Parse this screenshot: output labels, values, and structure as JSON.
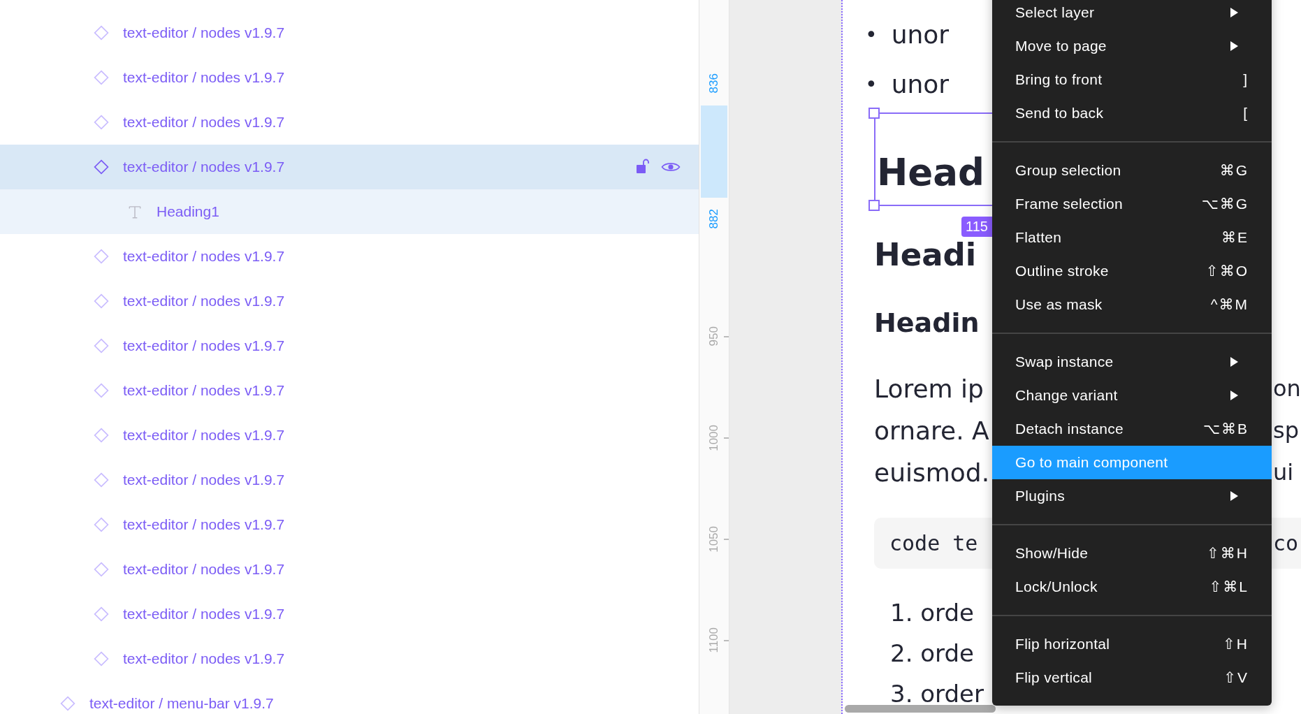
{
  "layers": [
    {
      "children": [
        {
          "name": "text-editor / nodes v1.9.7",
          "kind": "component",
          "selected": false
        },
        {
          "name": "text-editor / nodes v1.9.7",
          "kind": "component",
          "selected": false
        },
        {
          "name": "text-editor / nodes v1.9.7",
          "kind": "component",
          "selected": false
        },
        {
          "name": "text-editor / nodes v1.9.7",
          "kind": "component",
          "selected": true,
          "children": [
            {
              "name": "Heading1",
              "kind": "text",
              "selected": false
            }
          ]
        },
        {
          "name": "text-editor / nodes v1.9.7",
          "kind": "component",
          "selected": false
        },
        {
          "name": "text-editor / nodes v1.9.7",
          "kind": "component",
          "selected": false
        },
        {
          "name": "text-editor / nodes v1.9.7",
          "kind": "component",
          "selected": false
        },
        {
          "name": "text-editor / nodes v1.9.7",
          "kind": "component",
          "selected": false
        },
        {
          "name": "text-editor / nodes v1.9.7",
          "kind": "component",
          "selected": false
        },
        {
          "name": "text-editor / nodes v1.9.7",
          "kind": "component",
          "selected": false
        },
        {
          "name": "text-editor / nodes v1.9.7",
          "kind": "component",
          "selected": false
        },
        {
          "name": "text-editor / nodes v1.9.7",
          "kind": "component",
          "selected": false
        },
        {
          "name": "text-editor / nodes v1.9.7",
          "kind": "component",
          "selected": false
        },
        {
          "name": "text-editor / nodes v1.9.7",
          "kind": "component",
          "selected": false
        }
      ]
    },
    {
      "name": "text-editor / menu-bar v1.9.7",
      "kind": "component",
      "selected": false
    }
  ],
  "ruler": {
    "marks": [
      {
        "label": "836",
        "kind": "bound"
      },
      {
        "label": "882",
        "kind": "bound"
      },
      {
        "label": "950",
        "kind": "tick"
      },
      {
        "label": "1000",
        "kind": "tick"
      },
      {
        "label": "1050",
        "kind": "tick"
      },
      {
        "label": "1100",
        "kind": "tick"
      }
    ]
  },
  "canvas": {
    "lines": [
      {
        "kind": "bullet",
        "marker": "•",
        "text": "unor"
      },
      {
        "kind": "bullet",
        "marker": "•",
        "text": "unor"
      },
      {
        "kind": "h1",
        "text": "Head",
        "selected": true,
        "badge": "115"
      },
      {
        "kind": "h2",
        "text": "Headi"
      },
      {
        "kind": "h3",
        "text": "Headin"
      },
      {
        "kind": "p",
        "text": "Lorem ip",
        "right": "on"
      },
      {
        "kind": "p",
        "text": "ornare. A",
        "right": "sp"
      },
      {
        "kind": "p",
        "text": "euismod.",
        "right": "ui"
      },
      {
        "kind": "code",
        "text": "code te",
        "right": "co"
      },
      {
        "kind": "ordered",
        "text": "1. orde"
      },
      {
        "kind": "ordered",
        "text": "2. orde"
      },
      {
        "kind": "ordered",
        "text": "3. order"
      }
    ]
  },
  "context_menu": {
    "sections": [
      [
        {
          "label": "Select layer",
          "submenu": true,
          "selected": false
        },
        {
          "label": "Move to page",
          "submenu": true,
          "selected": false
        },
        {
          "label": "Bring to front",
          "shortcut": "]",
          "selected": false
        },
        {
          "label": "Send to back",
          "shortcut": "[",
          "selected": false
        }
      ],
      [
        {
          "label": "Group selection",
          "shortcut": "⌘G",
          "selected": false
        },
        {
          "label": "Frame selection",
          "shortcut": "⌥⌘G",
          "selected": false
        },
        {
          "label": "Flatten",
          "shortcut": "⌘E",
          "selected": false
        },
        {
          "label": "Outline stroke",
          "shortcut": "⇧⌘O",
          "selected": false
        },
        {
          "label": "Use as mask",
          "shortcut": "^⌘M",
          "selected": false
        }
      ],
      [
        {
          "label": "Swap instance",
          "submenu": true,
          "selected": false
        },
        {
          "label": "Change variant",
          "submenu": true,
          "selected": false
        },
        {
          "label": "Detach instance",
          "shortcut": "⌥⌘B",
          "selected": false
        },
        {
          "label": "Go to main component",
          "selected": true
        },
        {
          "label": "Plugins",
          "submenu": true,
          "selected": false
        }
      ],
      [
        {
          "label": "Show/Hide",
          "shortcut": "⇧⌘H",
          "selected": false
        },
        {
          "label": "Lock/Unlock",
          "shortcut": "⇧⌘L",
          "selected": false
        }
      ],
      [
        {
          "label": "Flip horizontal",
          "shortcut": "⇧H",
          "selected": false
        },
        {
          "label": "Flip vertical",
          "shortcut": "⇧V",
          "selected": false
        }
      ]
    ]
  }
}
